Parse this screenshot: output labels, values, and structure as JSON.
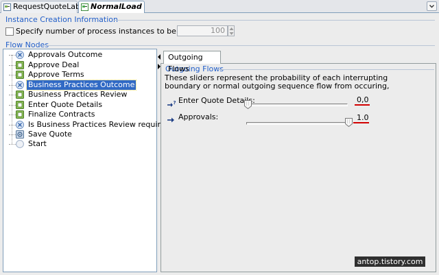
{
  "tabs": [
    {
      "label": "RequestQuoteLab",
      "icon": "process-icon"
    },
    {
      "label": "NormalLoad",
      "icon": "process-icon",
      "active": true
    }
  ],
  "instance_creation": {
    "title": "Instance Creation Information",
    "checkbox_label": "Specify number of process instances to be created",
    "checked": false,
    "count": "100"
  },
  "flow_nodes": {
    "title": "Flow Nodes",
    "items": [
      {
        "label": "Approvals Outcome",
        "icon": "gateway-icon"
      },
      {
        "label": "Approve Deal",
        "icon": "task-icon"
      },
      {
        "label": "Approve Terms",
        "icon": "task-icon"
      },
      {
        "label": "Business Practices Outcome",
        "icon": "gateway-icon",
        "selected": true
      },
      {
        "label": "Business Practices Review",
        "icon": "task-icon"
      },
      {
        "label": "Enter Quote Details",
        "icon": "task-icon"
      },
      {
        "label": "Finalize Contracts",
        "icon": "task-icon"
      },
      {
        "label": "Is Business Practices Review required?",
        "icon": "gateway-icon"
      },
      {
        "label": "Save Quote",
        "icon": "script-task-icon"
      },
      {
        "label": "Start",
        "icon": "start-event-icon"
      }
    ]
  },
  "outgoing": {
    "tab_label": "Outgoing Flows",
    "group_title": "Outgoing Flows",
    "description": "These sliders represent the probability of each interrupting boundary or normal outgoing sequence flow from occuring,",
    "rows": [
      {
        "label": "Enter Quote Details:",
        "value": "0,0",
        "fraction": 0.0,
        "icon": "conditional-flow-icon"
      },
      {
        "label": "Approvals:",
        "value": "1.0",
        "fraction": 1.0,
        "icon": "sequence-flow-icon"
      }
    ]
  },
  "watermark": "antop.tistory.com",
  "colors": {
    "accent": "#215ec9",
    "selection": "#316ac5",
    "annotation": "#d10000"
  }
}
